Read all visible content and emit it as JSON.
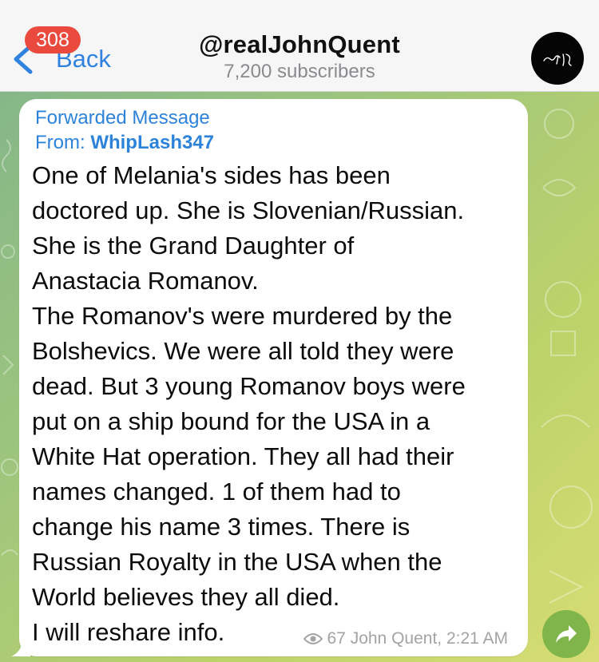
{
  "header": {
    "back_label": "Back",
    "unread_badge": "308",
    "channel_title": "@realJohnQuent",
    "subscribers": "7,200 subscribers"
  },
  "message": {
    "forward_label": "Forwarded Message",
    "from_prefix": "From: ",
    "from_name": "WhipLash347",
    "lines": [
      "One of Melania's sides has been",
      "doctored up. She is Slovenian/Russian.",
      "She is the Grand Daughter of",
      "Anastacia Romanov.",
      "The Romanov's were murdered by the",
      "Bolshevics. We were all told they were",
      "dead. But 3 young Romanov boys were",
      "put on a ship bound for the USA in a",
      "White Hat operation. They all had their",
      "names changed. 1 of them had to",
      "change his name 3 times. There is",
      "Russian Royalty in the USA when the",
      "World believes they all died.",
      "I will reshare info."
    ],
    "views": "67",
    "author_time": "John Quent, 2:21 AM"
  },
  "colors": {
    "accent": "#2d83d9",
    "badge": "#ea4a3d",
    "share_button": "#7fb54a"
  },
  "icons": [
    "chevron-left-icon",
    "channel-avatar-icon",
    "eye-icon",
    "share-arrow-icon"
  ]
}
